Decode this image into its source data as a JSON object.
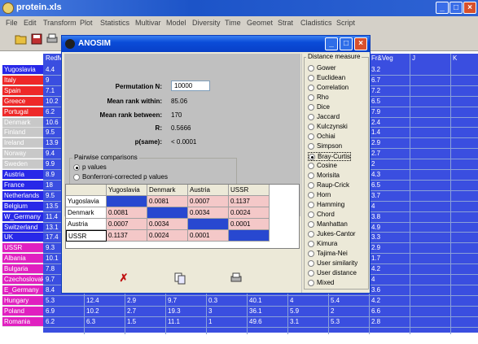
{
  "app": {
    "title": "protein.xls",
    "window_buttons": [
      "_",
      "□",
      "×"
    ]
  },
  "menu": [
    "File",
    "Edit",
    "Transform",
    "Plot",
    "Statistics",
    "Multivar",
    "Model",
    "Diversity",
    "Time",
    "Geomet",
    "Strat",
    "Cladistics",
    "Script"
  ],
  "toolbar": {
    "icons": [
      "open-folder-icon",
      "save-icon",
      "print-icon"
    ]
  },
  "sheet": {
    "columns_visible": [
      "RedM",
      "Fr&Veg",
      "J",
      "K"
    ],
    "rows": [
      {
        "label": "Yugoslavia",
        "color": "#2828e8",
        "vals": [
          "4.4"
        ],
        "fr": "3.2"
      },
      {
        "label": "Italy",
        "color": "#ee2828",
        "vals": [
          "9"
        ],
        "fr": "6.7"
      },
      {
        "label": "Spain",
        "color": "#ee2828",
        "vals": [
          "7.1"
        ],
        "fr": "7.2"
      },
      {
        "label": "Greece",
        "color": "#ee2828",
        "vals": [
          "10.2"
        ],
        "fr": "6.5"
      },
      {
        "label": "Portugal",
        "color": "#ee2828",
        "vals": [
          "6.2"
        ],
        "fr": "7.9"
      },
      {
        "label": "Denmark",
        "color": "#c8c8c8",
        "vals": [
          "10.6"
        ],
        "fr": "2.4"
      },
      {
        "label": "Finland",
        "color": "#c8c8c8",
        "vals": [
          "9.5"
        ],
        "fr": "1.4"
      },
      {
        "label": "Ireland",
        "color": "#c8c8c8",
        "vals": [
          "13.9"
        ],
        "fr": "2.9"
      },
      {
        "label": "Norway",
        "color": "#c8c8c8",
        "vals": [
          "9.4"
        ],
        "fr": "2.7"
      },
      {
        "label": "Sweden",
        "color": "#c8c8c8",
        "vals": [
          "9.9"
        ],
        "fr": "2"
      },
      {
        "label": "Austria",
        "color": "#2828e8",
        "vals": [
          "8.9"
        ],
        "fr": "4.3"
      },
      {
        "label": "France",
        "color": "#2828e8",
        "vals": [
          "18"
        ],
        "fr": "6.5"
      },
      {
        "label": "Netherlands",
        "color": "#2828e8",
        "vals": [
          "9.5"
        ],
        "fr": "3.7"
      },
      {
        "label": "Belgium",
        "color": "#2828e8",
        "vals": [
          "13.5"
        ],
        "fr": "4"
      },
      {
        "label": "W_Germany",
        "color": "#2828e8",
        "vals": [
          "11.4"
        ],
        "fr": "3.8"
      },
      {
        "label": "Switzerland",
        "color": "#2828e8",
        "vals": [
          "13.1"
        ],
        "fr": "4.9"
      },
      {
        "label": "UK",
        "color": "#2828e8",
        "vals": [
          "17.4"
        ],
        "fr": "3.3"
      },
      {
        "label": "USSR",
        "color": "#e020c0",
        "vals": [
          "9.3"
        ],
        "fr": "2.9"
      },
      {
        "label": "Albania",
        "color": "#e020c0",
        "vals": [
          "10.1"
        ],
        "fr": "1.7"
      },
      {
        "label": "Bulgaria",
        "color": "#e020c0",
        "vals": [
          "7.8"
        ],
        "fr": "4.2"
      },
      {
        "label": "Czechoslovakia",
        "color": "#e020c0",
        "vals": [
          "9.7"
        ],
        "fr": "4"
      },
      {
        "label": "E_Germany",
        "color": "#e020c0",
        "vals": [
          "8.4"
        ],
        "fr": "3.6"
      },
      {
        "label": "Hungary",
        "color": "#e020c0",
        "vals": [
          "5.3",
          "12.4",
          "2.9",
          "9.7",
          "0.3",
          "40.1",
          "4",
          "5.4"
        ],
        "fr": "4.2"
      },
      {
        "label": "Poland",
        "color": "#e020c0",
        "vals": [
          "6.9",
          "10.2",
          "2.7",
          "19.3",
          "3",
          "36.1",
          "5.9",
          "2"
        ],
        "fr": "6.6"
      },
      {
        "label": "Romania",
        "color": "#e020c0",
        "vals": [
          "6.2",
          "6.3",
          "1.5",
          "11.1",
          "1",
          "49.6",
          "3.1",
          "5.3"
        ],
        "fr": "2.8"
      }
    ]
  },
  "dialog": {
    "title": "ANOSIM",
    "permutation_label": "Permutation N:",
    "permutation_value": "10000",
    "stats": [
      {
        "label": "Mean rank within:",
        "value": "85.06"
      },
      {
        "label": "Mean rank between:",
        "value": "170"
      },
      {
        "label": "R:",
        "value": "0.5666"
      },
      {
        "label": "p(same):",
        "value": "< 0.0001"
      }
    ],
    "pairwise": {
      "title": "Pairwise comparisons",
      "options": [
        "p values",
        "Bonferroni-corrected p values",
        "R values"
      ],
      "selected": 0
    },
    "matrix": {
      "headers": [
        "",
        "Yugoslavia",
        "Denmark",
        "Austria",
        "USSR"
      ],
      "rows": [
        [
          "Yugoslavia",
          "",
          "0.0081",
          "0.0007",
          "0.1137"
        ],
        [
          "Denmark",
          "0.0081",
          "",
          "0.0034",
          "0.0024"
        ],
        [
          "Austria",
          "0.0007",
          "0.0034",
          "",
          "0.0001"
        ],
        [
          "USSR",
          "0.1137",
          "0.0024",
          "0.0001",
          ""
        ]
      ]
    },
    "distance": {
      "title": "Distance measure",
      "options": [
        "Gower",
        "Euclidean",
        "Correlation",
        "Rho",
        "Dice",
        "Jaccard",
        "Kulczynski",
        "Ochiai",
        "Simpson",
        "Bray-Curtis",
        "Cosine",
        "Morisita",
        "Raup-Crick",
        "Horn",
        "Hamming",
        "Chord",
        "Manhattan",
        "Jukes-Cantor",
        "Kimura",
        "Tajima-Nei",
        "User similarity",
        "User distance",
        "Mixed"
      ],
      "selected": 9
    },
    "buttons": [
      "close-icon",
      "copy-icon",
      "print-icon"
    ]
  },
  "colors": {
    "accent": "#0a4cd8",
    "matrix_highlight": "#f4c8c8",
    "matrix_diag": "#2848d0"
  }
}
